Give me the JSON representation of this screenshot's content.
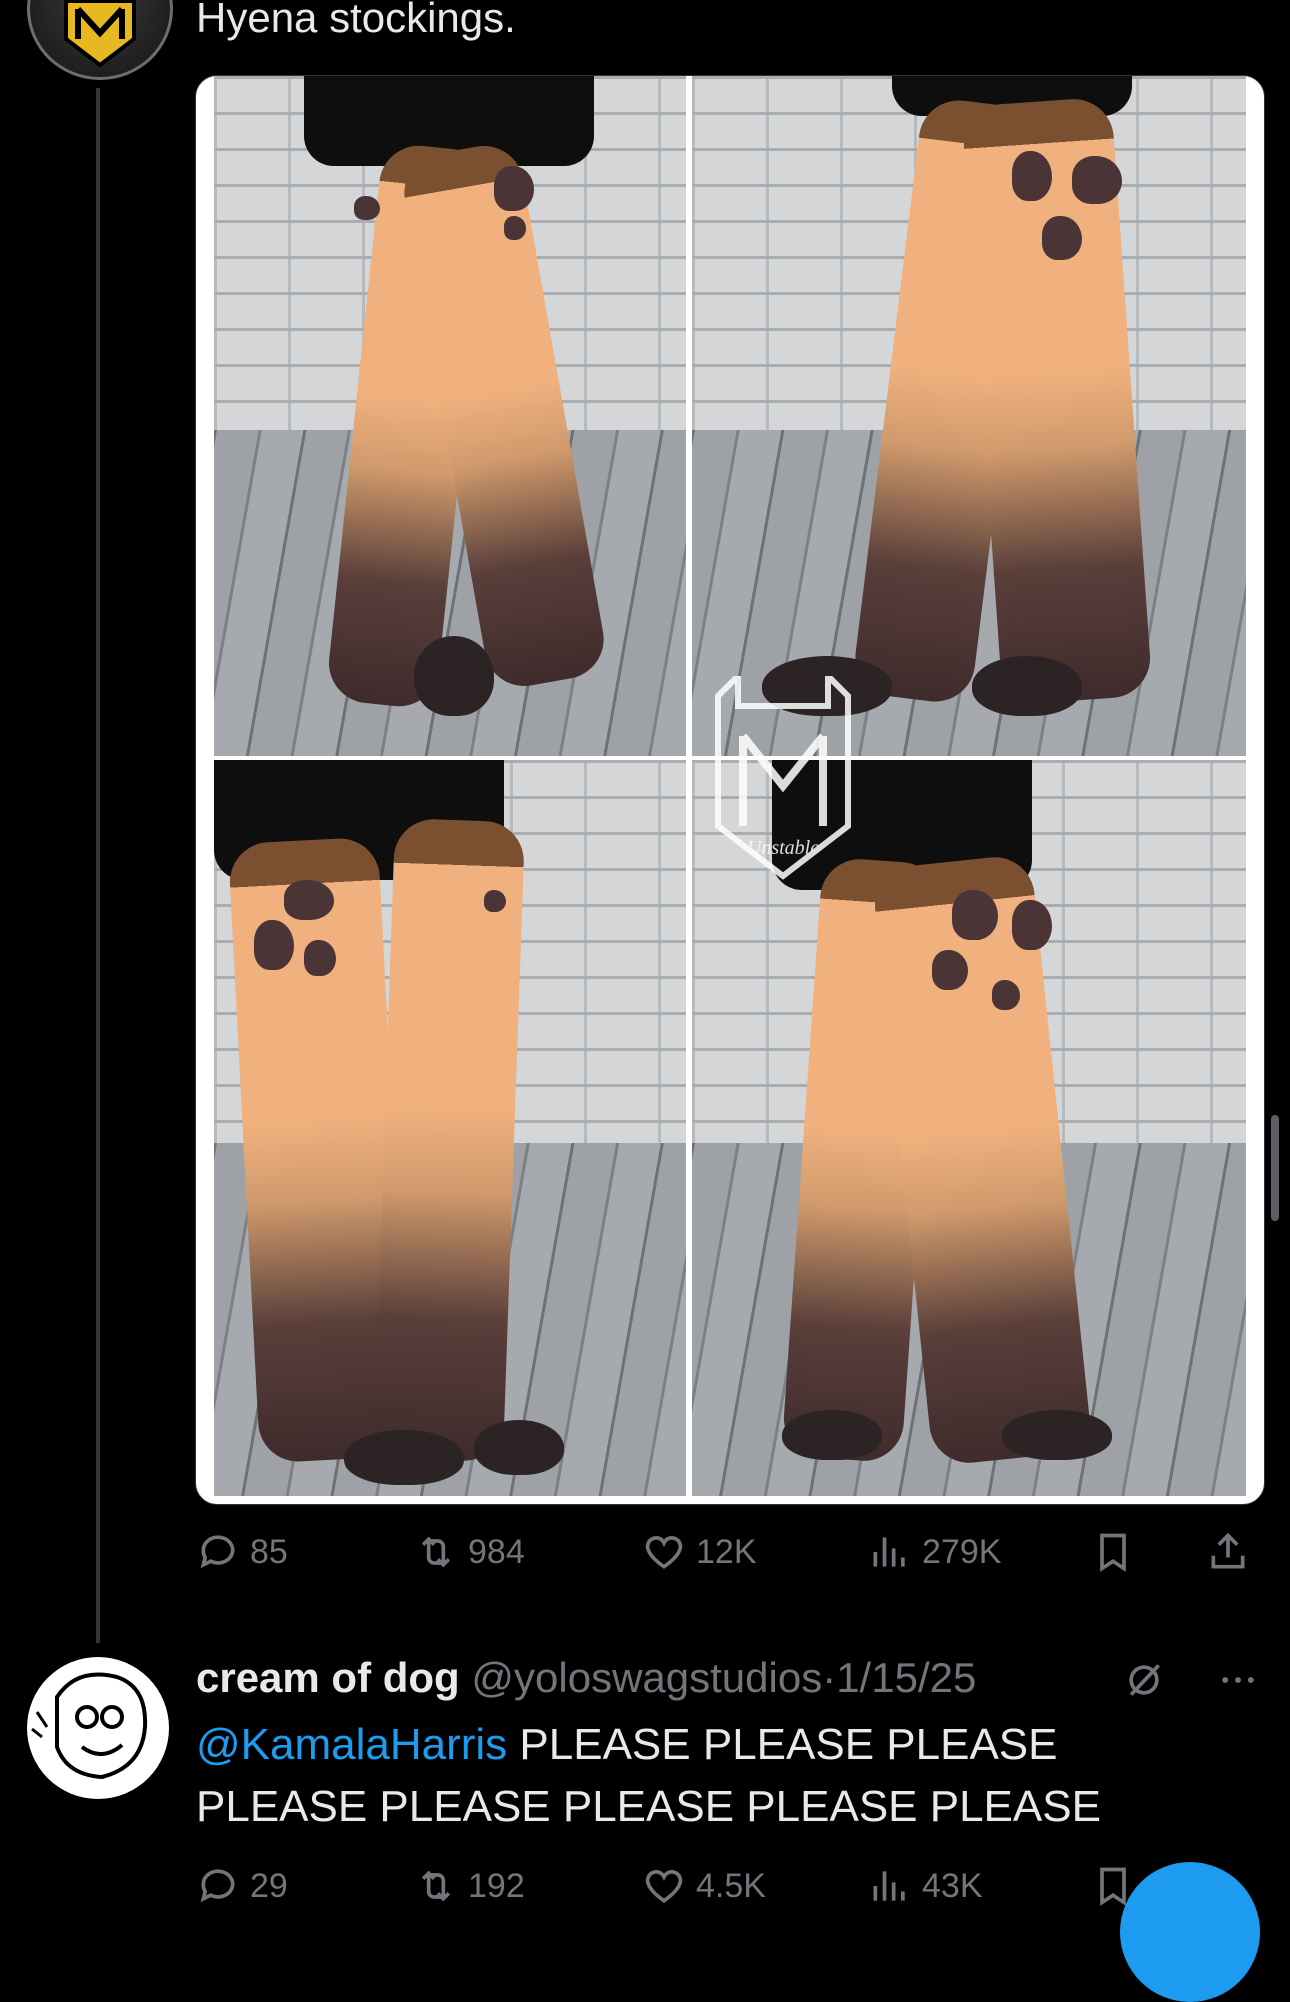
{
  "tweet": {
    "text": "Hyena stockings.",
    "media_alt": "Four photos of hyena-print thigh-high stockings with paw feet",
    "watermark_text": "Unstable",
    "stats": {
      "replies": "85",
      "reposts": "984",
      "likes": "12K",
      "views": "279K"
    }
  },
  "reply": {
    "name": "cream of dog",
    "handle": "@yoloswagstudios",
    "separator": "·",
    "date": "1/15/25",
    "mention": "@KamalaHarris",
    "text": " PLEASE PLEASE PLEASE PLEASE PLEASE PLEASE PLEASE PLEASE",
    "stats": {
      "replies": "29",
      "reposts": "192",
      "likes": "4.5K",
      "views": "43K"
    }
  },
  "colors": {
    "accent": "#1d9bf0",
    "muted": "#71767b",
    "text": "#e7e9ea",
    "bg": "#000000"
  }
}
